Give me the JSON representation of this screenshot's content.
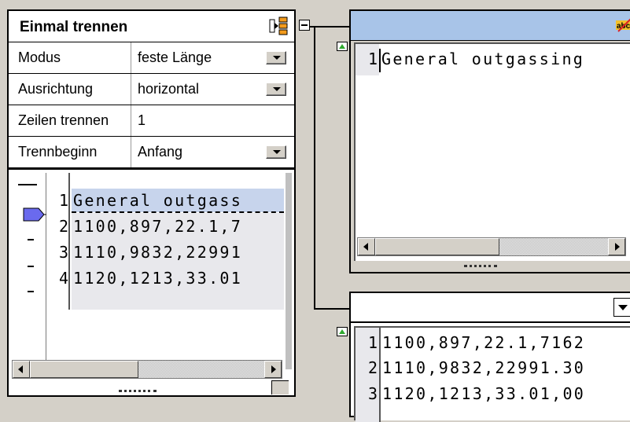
{
  "split_component": {
    "title": "Einmal trennen",
    "properties": [
      {
        "label": "Modus",
        "value": "feste Länge",
        "has_dropdown": true
      },
      {
        "label": "Ausrichtung",
        "value": "horizontal",
        "has_dropdown": true
      },
      {
        "label": "Zeilen trennen",
        "value": "1",
        "has_dropdown": false
      },
      {
        "label": "Trennbeginn",
        "value": "Anfang",
        "has_dropdown": true
      }
    ],
    "preview": {
      "line_numbers": [
        "1",
        "2",
        "3",
        "4"
      ],
      "lines": [
        "General outgass",
        "1100,897,22.1,7",
        "1110,9832,22991",
        "1120,1213,33.01"
      ]
    }
  },
  "top_right_component": {
    "icon": "spellcheck-icon",
    "line_numbers": [
      "1"
    ],
    "lines": [
      "General outgassing"
    ]
  },
  "bottom_right_component": {
    "line_numbers": [
      "1",
      "2",
      "3"
    ],
    "lines": [
      "1100,897,22.1,7162",
      "1110,9832,22991.30",
      "1120,1213,33.01,00"
    ]
  },
  "colors": {
    "canvas_bg": "#d4d0c8",
    "header_blue": "#a8c4e8",
    "selected_line": "#c7d4ec",
    "marker": "#6a6aee"
  }
}
